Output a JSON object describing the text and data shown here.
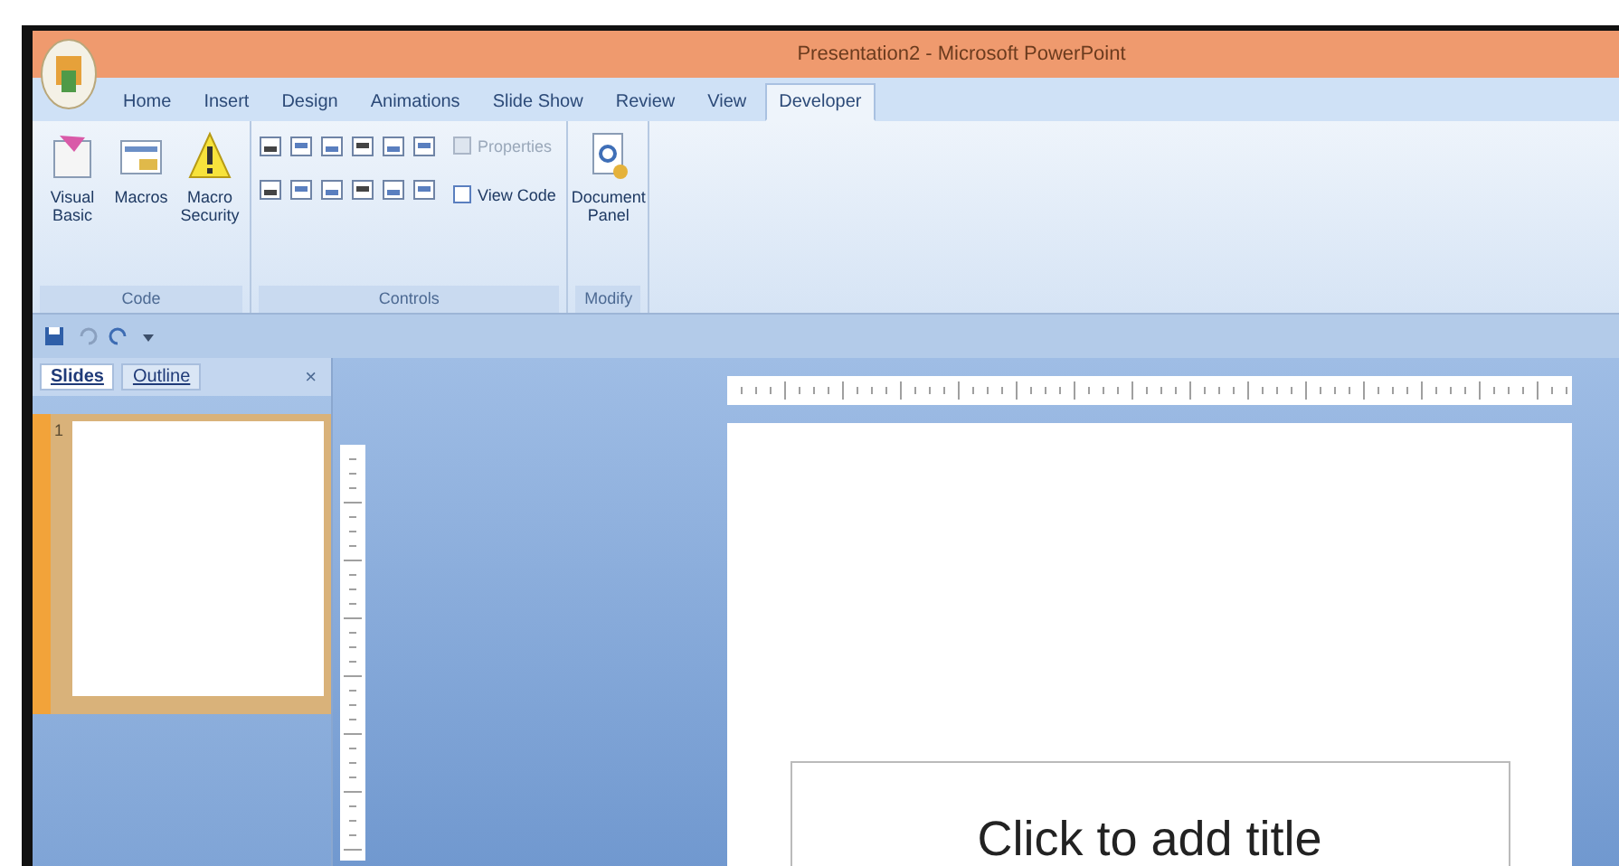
{
  "window": {
    "title": "Presentation2 - Microsoft PowerPoint"
  },
  "tabs": [
    {
      "label": "Home",
      "selected": false
    },
    {
      "label": "Insert",
      "selected": false
    },
    {
      "label": "Design",
      "selected": false
    },
    {
      "label": "Animations",
      "selected": false
    },
    {
      "label": "Slide Show",
      "selected": false
    },
    {
      "label": "Review",
      "selected": false
    },
    {
      "label": "View",
      "selected": false
    },
    {
      "label": "Developer",
      "selected": true
    }
  ],
  "ribbon": {
    "groups": [
      {
        "label": "Code",
        "kind": "large",
        "buttons": [
          {
            "label": "Visual Basic",
            "kind": "vb"
          },
          {
            "label": "Macros",
            "kind": "macros"
          },
          {
            "label": "Macro Security",
            "kind": "security"
          }
        ]
      },
      {
        "label": "Controls",
        "kind": "controls",
        "commands": [
          {
            "label": "Properties",
            "disabled": true
          },
          {
            "label": "View Code",
            "disabled": false
          }
        ]
      },
      {
        "label": "Modify",
        "kind": "large",
        "buttons": [
          {
            "label": "Document Panel",
            "kind": "panel"
          }
        ]
      }
    ]
  },
  "pane_tabs": [
    {
      "label": "Slides",
      "selected": true
    },
    {
      "label": "Outline",
      "selected": false
    }
  ],
  "pane_close": "×",
  "slides": [
    {
      "number": "1",
      "selected": true
    }
  ],
  "slide": {
    "title_placeholder": "Click to add title"
  }
}
